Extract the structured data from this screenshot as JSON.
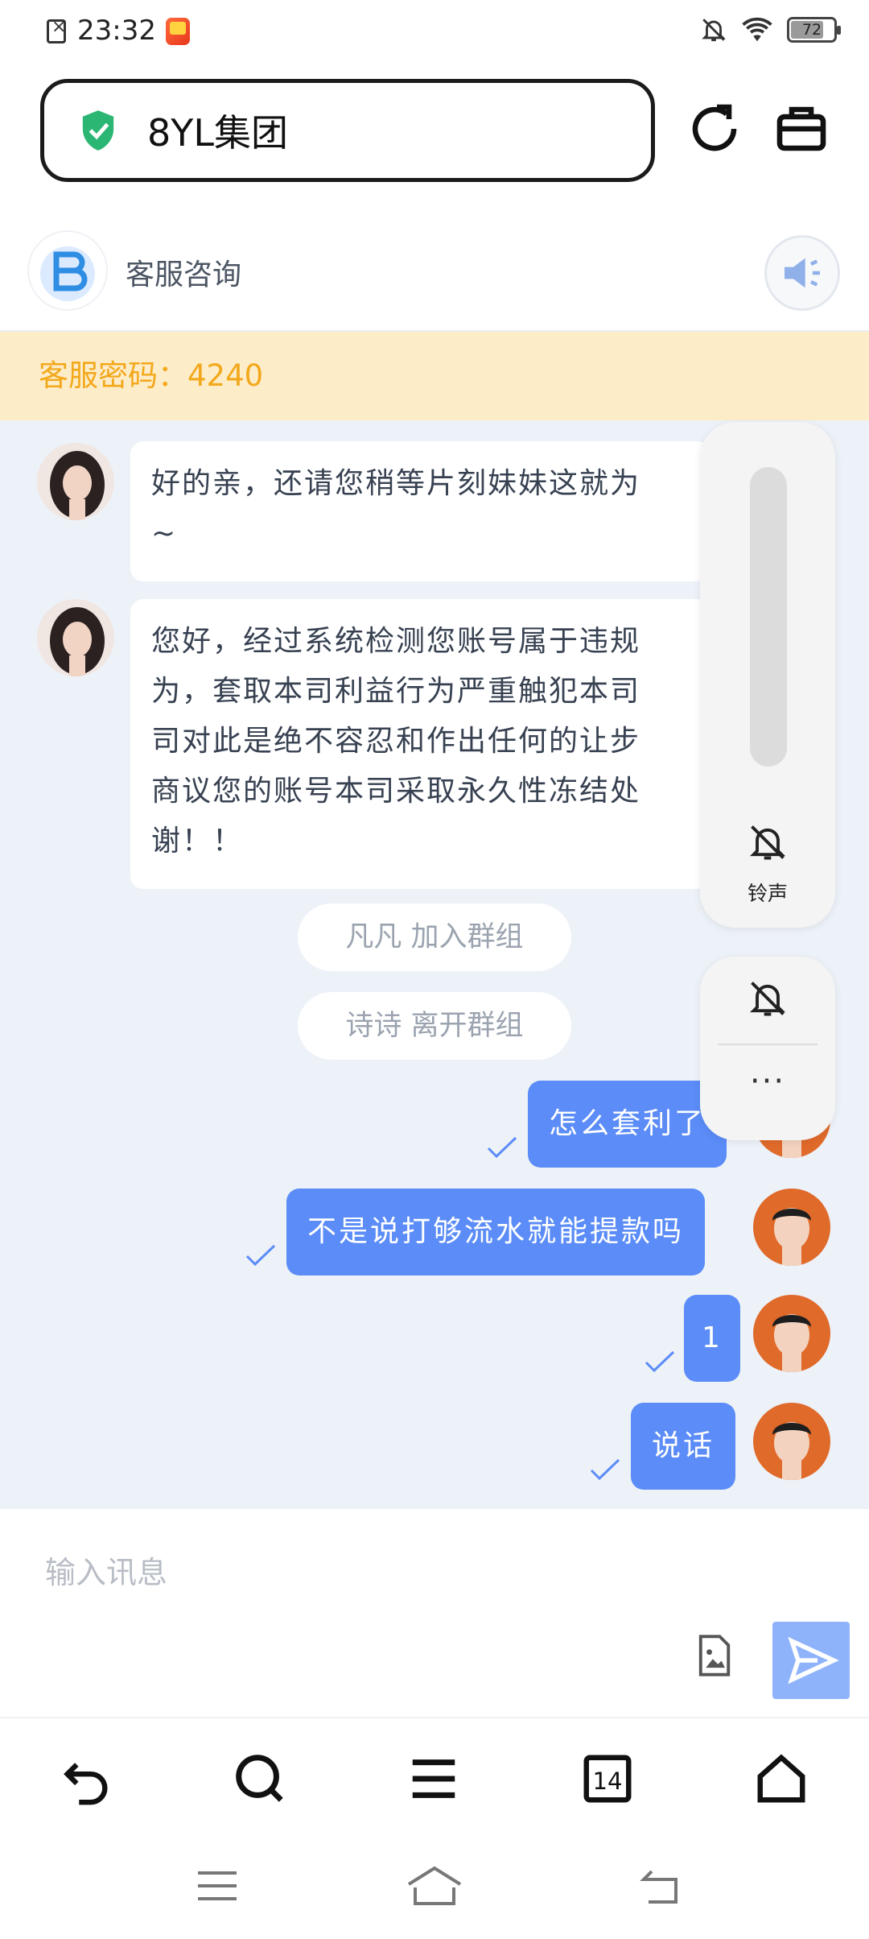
{
  "status_bar": {
    "time": "23:32",
    "battery": "72",
    "battery_level": 0.72
  },
  "browser": {
    "url": "8YL集团",
    "reload_icon": "reload-icon",
    "toolbox_icon": "briefcase-icon"
  },
  "chat": {
    "title": "客服咨询",
    "password_label": "客服密码：",
    "password": "4240",
    "messages_in": [
      {
        "lines": [
          "好的亲，还请您稍等片刻妹妹这就为",
          "~"
        ]
      },
      {
        "lines": [
          "您好，经过系统检测您账号属于违规",
          "为，套取本司利益行为严重触犯本司",
          "司对此是绝不容忍和作出任何的让步",
          "商议您的账号本司采取永久性冻结处",
          "谢！！"
        ]
      }
    ],
    "notices": [
      "凡凡 加入群组",
      "诗诗 离开群组"
    ],
    "messages_out": [
      "怎么套利了",
      "不是说打够流水就能提款吗",
      "1",
      "说话"
    ]
  },
  "floating": {
    "ringtone_label": "铃声",
    "more": "···"
  },
  "input": {
    "placeholder": "输入讯息"
  },
  "colors": {
    "accent": "#5b8cf7",
    "send": "#8fb3fb",
    "password_bg": "#fdecc8",
    "password_text": "#f3a81b",
    "chat_bg": "#edf1f8"
  }
}
